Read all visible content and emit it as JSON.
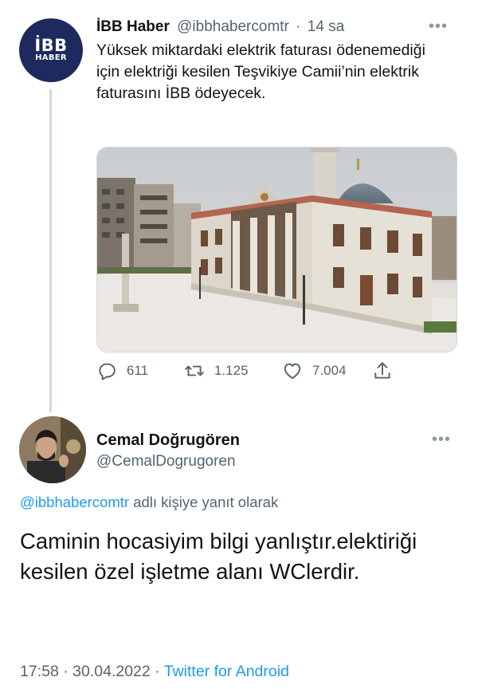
{
  "tweet": {
    "avatar": {
      "line1": "İBB",
      "line2": "HABER"
    },
    "display_name": "İBB Haber",
    "handle": "@ibbhabercomtr",
    "separator": "·",
    "time": "14 sa",
    "text": "Yüksek miktardaki elektrik faturası ödenemediği için elektriği kesilen Teşvikiye Camii’nin elektrik faturasını İBB ödeyecek.",
    "actions": {
      "replies": {
        "icon": "reply-icon",
        "count": "611"
      },
      "retweets": {
        "icon": "retweet-icon",
        "count": "1.125"
      },
      "likes": {
        "icon": "heart-icon",
        "count": "7.004"
      },
      "share": {
        "icon": "share-icon"
      }
    },
    "more_icon": "more-icon"
  },
  "reply": {
    "display_name": "Cemal Doğrugören",
    "handle": "@CemalDogrugoren",
    "replying_to_mention": "@ibbhabercomtr",
    "replying_to_suffix": "adlı kişiye yanıt olarak",
    "text": "Caminin hocasiyim bilgi yanlıştır.elektiriği kesilen özel işletme alanı WClerdir.",
    "time": "17:58",
    "separator": "·",
    "date": "30.04.2022",
    "source": "Twitter for Android",
    "more_icon": "more-icon"
  },
  "colors": {
    "link": "#1d9bf0",
    "secondary_text": "#536471",
    "ibb_avatar": "#1e2a5e"
  }
}
